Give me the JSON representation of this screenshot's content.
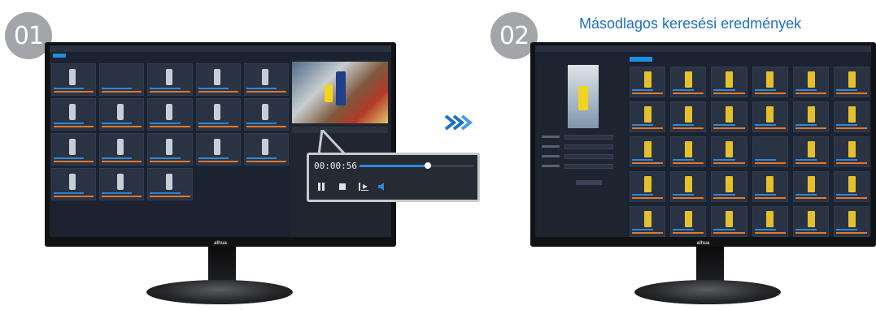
{
  "steps": [
    {
      "number": "01"
    },
    {
      "number": "02"
    }
  ],
  "headline": "Másodlagos keresési eredmények",
  "monitor_brand": "alhua",
  "playback": {
    "time": "00:00:56",
    "progress": 0.6
  },
  "colors": {
    "accent_blue": "#1f6fc6",
    "badge_gray": "#a3a5a8",
    "progress_blue": "#2f86d8"
  },
  "icons": {
    "arrow": "double-chevron-right-icon",
    "pause": "pause-icon",
    "stop": "stop-icon",
    "step": "frame-step-icon",
    "volume": "volume-icon"
  }
}
